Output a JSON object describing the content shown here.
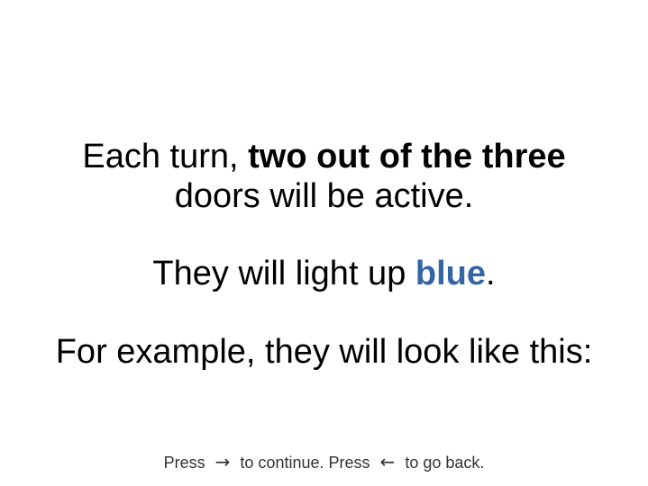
{
  "instructions": {
    "line1_prefix": "Each turn, ",
    "line1_bold": "two out of the three",
    "line2": "doors will be active.",
    "para2_prefix": "They will light up ",
    "para2_highlight": "blue",
    "para2_suffix": ".",
    "para3": "For example, they will look like this:"
  },
  "footer": {
    "press_1": "Press",
    "forward_arrow": "→",
    "continue_text": "to continue. Press",
    "back_arrow": "←",
    "back_text": "to go back."
  },
  "colors": {
    "highlight": "#3465a4",
    "text": "#000000",
    "footer_text": "#333333"
  },
  "icons": {
    "forward": "right-arrow-icon",
    "back": "left-arrow-icon"
  }
}
